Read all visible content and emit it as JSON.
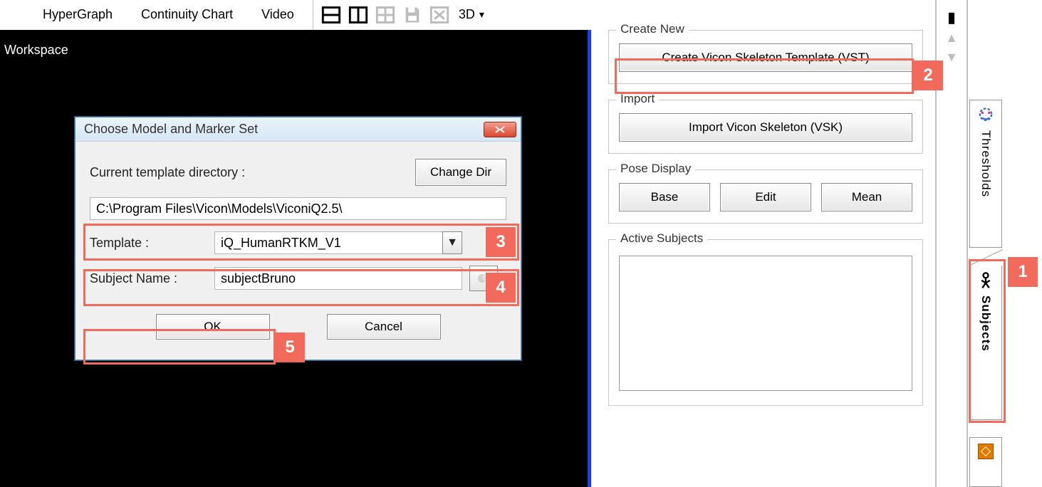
{
  "toolbar": {
    "hypergraph": "HyperGraph",
    "continuity": "Continuity Chart",
    "video": "Video",
    "mode3d": "3D"
  },
  "workspace": {
    "label": "Workspace"
  },
  "dialog": {
    "title": "Choose Model and Marker Set",
    "cur_dir_label": "Current template directory :",
    "change_dir": "Change Dir",
    "dir_value": "C:\\Program Files\\Vicon\\Models\\ViconiQ2.5\\",
    "template_label": "Template :",
    "template_value": "iQ_HumanRTKM_V1",
    "subject_label": "Subject Name :",
    "subject_value": "subjectBruno",
    "ok": "OK",
    "cancel": "Cancel"
  },
  "panel": {
    "create_new": "Create New",
    "create_vst": "Create Vicon Skeleton Template (VST)",
    "import": "Import",
    "import_vsk": "Import Vicon Skeleton  (VSK)",
    "pose_display": "Pose Display",
    "base": "Base",
    "edit": "Edit",
    "mean": "Mean",
    "active_subjects": "Active Subjects"
  },
  "sidetabs": {
    "thresholds": "Thresholds",
    "subjects": "Subjects"
  },
  "callouts": {
    "n1": "1",
    "n2": "2",
    "n3": "3",
    "n4": "4",
    "n5": "5"
  }
}
